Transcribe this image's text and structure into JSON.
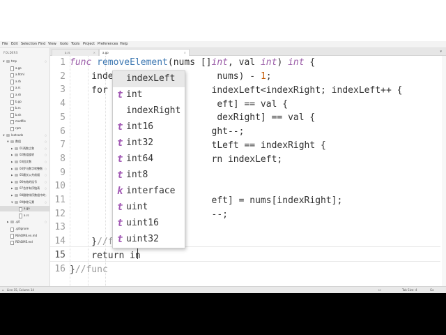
{
  "menu": [
    "File",
    "Edit",
    "Selection",
    "Find",
    "View",
    "Goto",
    "Tools",
    "Project",
    "Preferences",
    "Help"
  ],
  "sidebar": {
    "header": "FOLDERS",
    "tree": [
      {
        "label": "tmp",
        "kind": "folder",
        "expanded": true
      },
      {
        "label": "a.go",
        "kind": "file"
      },
      {
        "label": "a.html",
        "kind": "file"
      },
      {
        "label": "a.rb",
        "kind": "file"
      },
      {
        "label": "a.rs",
        "kind": "file"
      },
      {
        "label": "a.sh",
        "kind": "file"
      },
      {
        "label": "b.go",
        "kind": "file"
      },
      {
        "label": "b.rs",
        "kind": "file"
      },
      {
        "label": "b.sh",
        "kind": "file"
      },
      {
        "label": "modfile",
        "kind": "file"
      },
      {
        "label": "rpm",
        "kind": "file"
      },
      {
        "label": "leetcode",
        "kind": "folder",
        "expanded": true
      },
      {
        "label": "数组",
        "kind": "folder",
        "expanded": true
      },
      {
        "label": "01两数之和",
        "kind": "folder",
        "expanded": false
      },
      {
        "label": "02数组旋转",
        "kind": "folder",
        "expanded": false
      },
      {
        "label": "03回文数",
        "kind": "folder",
        "expanded": false
      },
      {
        "label": "04罗马数字转整数",
        "kind": "folder",
        "expanded": false
      },
      {
        "label": "05最长公共前缀",
        "kind": "folder",
        "expanded": false
      },
      {
        "label": "06有效的括号",
        "kind": "folder",
        "expanded": false
      },
      {
        "label": "07合并有序链表",
        "kind": "folder",
        "expanded": false
      },
      {
        "label": "08删除排序数组中的",
        "kind": "folder",
        "expanded": false
      },
      {
        "label": "09移除元素",
        "kind": "folder",
        "expanded": true
      },
      {
        "label": "a.go",
        "kind": "file",
        "selected": true
      },
      {
        "label": "a.rs",
        "kind": "file"
      },
      {
        "label": ".git",
        "kind": "folder",
        "expanded": false
      },
      {
        "label": ".gitignore",
        "kind": "file"
      },
      {
        "label": "README.en.md",
        "kind": "file"
      },
      {
        "label": "README.md",
        "kind": "file"
      }
    ]
  },
  "tabs": [
    {
      "label": "a.rs",
      "close": "×"
    },
    {
      "label": "a.go",
      "close": "×"
    }
  ],
  "tab_overflow": "▾",
  "editor": {
    "line_numbers": [
      "1",
      "2",
      "3",
      "4",
      "5",
      "6",
      "7",
      "8",
      "9",
      "10",
      "11",
      "12",
      "13",
      "14",
      "15",
      "16"
    ],
    "current_line": "15"
  },
  "autocomplete": {
    "items": [
      {
        "icon": "",
        "text": "indexLeft"
      },
      {
        "icon": "t",
        "text": "int"
      },
      {
        "icon": "",
        "text": "indexRight"
      },
      {
        "icon": "t",
        "text": "int16"
      },
      {
        "icon": "t",
        "text": "int32"
      },
      {
        "icon": "t",
        "text": "int64"
      },
      {
        "icon": "t",
        "text": "int8"
      },
      {
        "icon": "k",
        "text": "interface"
      },
      {
        "icon": "t",
        "text": "uint"
      },
      {
        "icon": "t",
        "text": "uint16"
      },
      {
        "icon": "t",
        "text": "uint32"
      }
    ]
  },
  "status": {
    "position": "Line 15, Column 14",
    "tab_size": "Tab Size: 4",
    "syntax": "Go"
  },
  "colors": {
    "keyword": "#9b5da8",
    "function": "#3e78b2",
    "number": "#c65d09",
    "comment": "#9a9a9a",
    "text": "#333333"
  }
}
